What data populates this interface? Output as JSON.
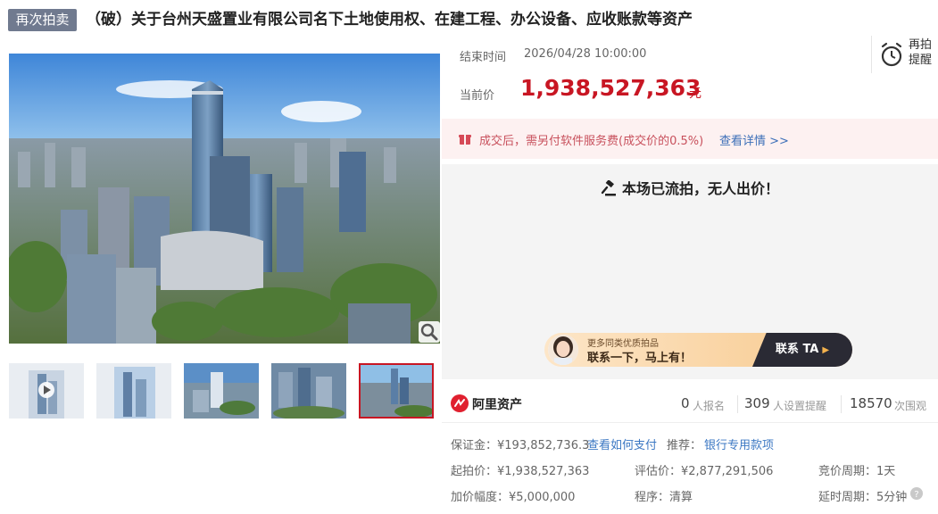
{
  "header": {
    "tag": "再次拍卖",
    "title": "（破）关于台州天盛置业有限公司名下土地使用权、在建工程、办公设备、应收账款等资产"
  },
  "gallery": {
    "thumb_count": 5,
    "active_index": 4
  },
  "auction": {
    "end_label": "结束时间",
    "end_time": "2026/04/28 10:00:00",
    "price_label": "当前价",
    "price": "1,938,527,363",
    "price_unit": "元",
    "remind_line1": "再拍",
    "remind_line2": "提醒",
    "fee_text": "成交后，需另付软件服务费(成交价的0.5%)",
    "fee_link": "查看详情 >>",
    "status": "本场已流拍，无人出价！"
  },
  "contact": {
    "line1": "更多同类优质拍品",
    "line2": "联系一下，马上有！",
    "button": "联系 TA"
  },
  "stats": {
    "brand": "阿里资产",
    "signups": "0",
    "signups_label": "人报名",
    "reminders": "309",
    "reminders_label": "人设置提醒",
    "views": "18570",
    "views_label": "次围观"
  },
  "details": {
    "deposit": "保证金：¥193,852,736.3",
    "deposit_link": "查看如何支付",
    "recommend_label": "推荐：",
    "recommend_link": "银行专用款项",
    "start_price": "起拍价：¥1,938,527,363",
    "appraisal": "评估价：¥2,877,291,506",
    "bid_cycle": "竞价周期：1天",
    "increment": "加价幅度：¥5,000,000",
    "procedure": "程序：清算",
    "delay_cycle": "延时周期：5分钟"
  },
  "colors": {
    "accent": "#c81623",
    "tag_bg": "#707a8f",
    "link": "#3c78c3"
  }
}
